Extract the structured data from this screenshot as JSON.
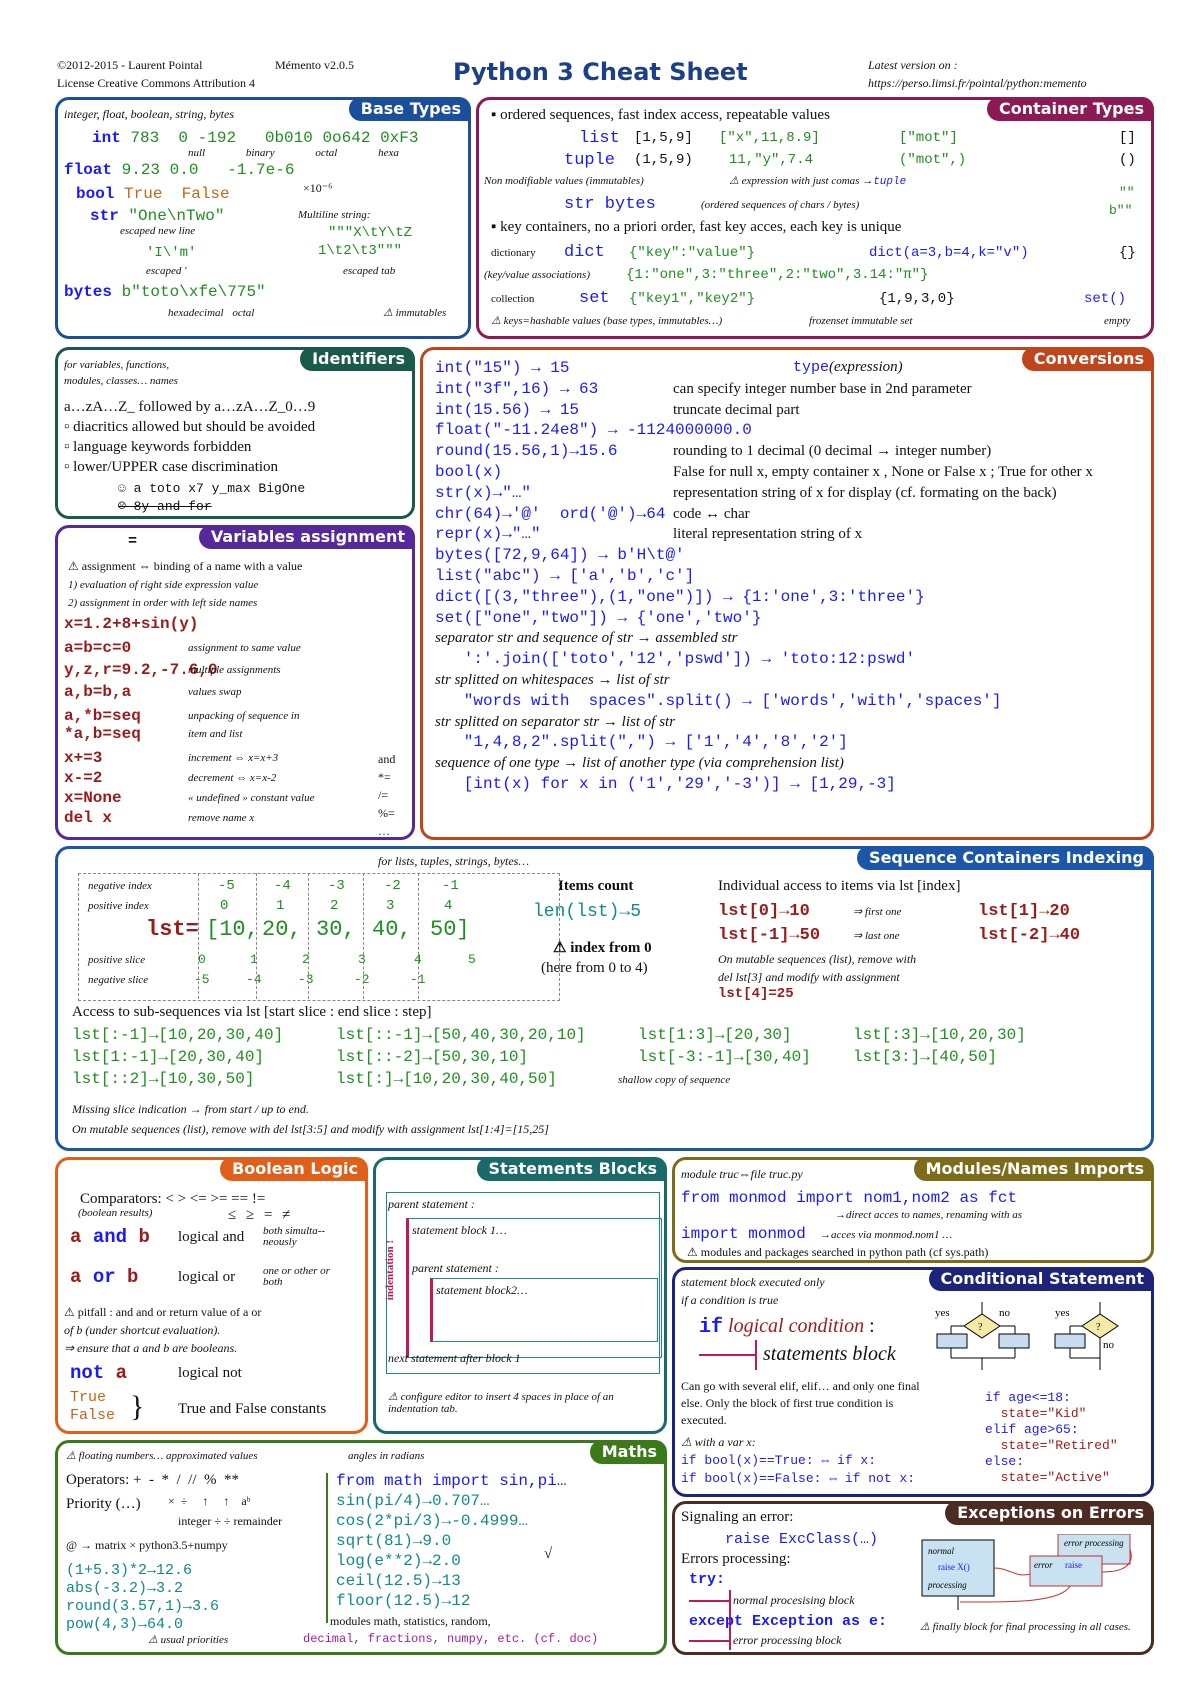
{
  "header": {
    "copyright": "©2012-2015 - Laurent Pointal",
    "version": "Mémento v2.0.5",
    "license": "License Creative Commons Attribution 4",
    "title": "Python 3 Cheat Sheet",
    "latest_label": "Latest version on :",
    "latest_url": "https://perso.limsi.fr/pointal/python:memento"
  },
  "base_types": {
    "title": "Base Types",
    "subtitle": "integer, float, boolean, string, bytes",
    "int_kw": "int",
    "int_vals": "783  0 -192   0b010 0o642 0xF3",
    "int_notes": [
      "null",
      "binary",
      "octal",
      "hexa"
    ],
    "float_kw": "float",
    "float_vals": "9.23 0.0   -1.7e-6",
    "float_note": "×10⁻⁶",
    "bool_kw": "bool",
    "bool_vals": "True  False",
    "str_kw": "str",
    "str_val": "\"One\\nTwo\"",
    "escaped_newline": "escaped new line",
    "multiline_label": "Multiline string:",
    "multiline_1": "\"\"\"X\\tY\\tZ",
    "multiline_2": "1\\t2\\t3\"\"\"",
    "str_val2": "'I\\'m'",
    "escaped_quote": "escaped '",
    "escaped_tab": "escaped tab",
    "bytes_kw": "bytes",
    "bytes_val": "b\"toto\\xfe\\775\"",
    "hex_note": "hexadecimal  octal",
    "immutables": "⚠ immutables"
  },
  "container_types": {
    "title": "Container Types",
    "ordered": "▪ ordered sequences, fast index access, repeatable values",
    "list_kw": "list",
    "list_v1": "[1,5,9]",
    "list_v2": "[\"x\",11,8.9]",
    "list_v3": "[\"mot\"]",
    "list_empty": "[]",
    "tuple_kw": "tuple",
    "tuple_v1": "(1,5,9)",
    "tuple_v2": "11,\"y\",7.4",
    "tuple_v3": "(\"mot\",)",
    "tuple_empty": "()",
    "nonmod": "Non modifiable values (immutables)",
    "expr_commas": "⚠ expression with just comas →",
    "expr_tuple": "tuple",
    "strbytes_kw": "str bytes",
    "strbytes_note": "(ordered sequences of chars / bytes)",
    "str_empty": "\"\"",
    "bytes_empty": "b\"\"",
    "key_containers": "▪ key containers, no a priori order, fast key acces, each key is unique",
    "dict_label": "dictionary",
    "dict_kw": "dict",
    "dict_v1": "{\"key\":\"value\"}",
    "dict_v2": "dict(a=3,b=4,k=\"v\")",
    "dict_empty": "{}",
    "dict_assoc": "(key/value associations)",
    "dict_v3": "{1:\"one\",3:\"three\",2:\"two\",3.14:\"π\"}",
    "set_label": "collection",
    "set_kw": "set",
    "set_v1": "{\"key1\",\"key2\"}",
    "set_v2": "{1,9,3,0}",
    "set_empty": "set()",
    "keys_hashable": "⚠ keys=hashable values (base types, immutables…)",
    "frozenset": "frozenset immutable set",
    "empty": "empty"
  },
  "identifiers": {
    "title": "Identifiers",
    "sub1": "for variables, functions,",
    "sub2": "modules, classes… names",
    "rule": "a…zA…Z_ followed by a…zA…Z_0…9",
    "bullets": [
      "diacritics allowed but should be avoided",
      "language keywords forbidden",
      "lower/UPPER case discrimination"
    ],
    "good": "☺ a toto x7 y_max BigOne",
    "bad": "☹ 8y and for"
  },
  "variables": {
    "title": "Variables assignment",
    "eq": "=",
    "binding": "⚠ assignment ⇔ binding of a name with a value",
    "step1": "1) evaluation of right side expression value",
    "step2": "2) assignment in order with left side names",
    "rows": [
      {
        "code": "x=1.2+8+sin(y)",
        "note": ""
      },
      {
        "code": "a=b=c=0",
        "note": "assignment to same value"
      },
      {
        "code": "y,z,r=9.2,-7.6,0",
        "note": "multiple assignments"
      },
      {
        "code": "a,b=b,a",
        "note": "values swap"
      },
      {
        "code": "a,*b=seq",
        "note": "unpacking of sequence in"
      },
      {
        "code": "*a,b=seq",
        "note": "item and list"
      },
      {
        "code": "x+=3",
        "note": "increment ⇔ x=x+3"
      },
      {
        "code": "x-=2",
        "note": "decrement ⇔ x=x-2"
      },
      {
        "code": "x=None",
        "note": "« undefined » constant value"
      },
      {
        "code": "del x",
        "note": "remove name x"
      }
    ],
    "ops": [
      "and",
      "*=",
      "/=",
      "%=",
      "…"
    ]
  },
  "conversions": {
    "title": "Conversions",
    "type_expr": "type(expression)",
    "rows": [
      {
        "code": "int(\"15\") → 15",
        "note": ""
      },
      {
        "code": "int(\"3f\",16) → 63",
        "note": "can specify integer number base in 2nd parameter"
      },
      {
        "code": "int(15.56) → 15",
        "note": "truncate decimal part"
      },
      {
        "code": "float(\"-11.24e8\") → -1124000000.0",
        "note": ""
      },
      {
        "code": "round(15.56,1)→15.6",
        "note": "rounding to 1 decimal (0 decimal → integer number)"
      },
      {
        "code": "bool(x)",
        "note": "False for null x, empty container x , None or False x ; True for other x"
      },
      {
        "code": "str(x)→\"…\"",
        "note": "representation string of x for display (cf. formating on the back)"
      },
      {
        "code": "chr(64)→'@'  ord('@')→64",
        "note": "code ↔ char"
      },
      {
        "code": "repr(x)→\"…\"",
        "note": "literal representation string of x"
      },
      {
        "code": "bytes([72,9,64]) → b'H\\t@'",
        "note": ""
      },
      {
        "code": "list(\"abc\") → ['a','b','c']",
        "note": ""
      },
      {
        "code": "dict([(3,\"three\"),(1,\"one\")]) → {1:'one',3:'three'}",
        "note": ""
      },
      {
        "code": "set([\"one\",\"two\"]) → {'one','two'}",
        "note": ""
      },
      {
        "code": "",
        "note": "separator str and sequence of str → assembled str"
      },
      {
        "code": "   ':'.join(['toto','12','pswd']) → 'toto:12:pswd'",
        "note": ""
      },
      {
        "code": "",
        "note": "str splitted on whitespaces → list of str"
      },
      {
        "code": "   \"words with  spaces\".split() → ['words','with','spaces']",
        "note": ""
      },
      {
        "code": "",
        "note": "str splitted on separator str → list of str"
      },
      {
        "code": "   \"1,4,8,2\".split(\",\") → ['1','4','8','2']",
        "note": ""
      },
      {
        "code": "",
        "note": "sequence of one type → list of another type (via comprehension list)"
      },
      {
        "code": "   [int(x) for x in ('1','29','-3')] → [1,29,-3]",
        "note": ""
      }
    ]
  },
  "sequence_indexing": {
    "title": "Sequence Containers Indexing",
    "subtitle": "for lists, tuples, strings, bytes…",
    "neg_index_label": "negative index",
    "neg_index": [
      "-5",
      "-4",
      "-3",
      "-2",
      "-1"
    ],
    "pos_index_label": "positive index",
    "pos_index": [
      "0",
      "1",
      "2",
      "3",
      "4"
    ],
    "lst_label": "lst=",
    "lst_values": [
      "[10,",
      "20,",
      "30,",
      "40,",
      "50]"
    ],
    "pos_slice_label": "positive slice",
    "pos_slice": [
      "0",
      "1",
      "2",
      "3",
      "4",
      "5"
    ],
    "neg_slice_label": "negative slice",
    "neg_slice": [
      "-5",
      "-4",
      "-3",
      "-2",
      "-1"
    ],
    "items_count": "Items count",
    "len": "len(lst)→5",
    "index_from0": "⚠ index from 0",
    "here": "(here from 0 to 4)",
    "individual": "Individual access to items via lst [index]",
    "access": [
      {
        "code": "lst[0]→10",
        "note": "⇒ first one"
      },
      {
        "code": "lst[1]→20",
        "note": ""
      },
      {
        "code": "lst[-1]→50",
        "note": "⇒ last one"
      },
      {
        "code": "lst[-2]→40",
        "note": ""
      }
    ],
    "mutable1": "On mutable sequences (list), remove with",
    "mutable2": "del lst[3] and modify with assignment",
    "mutable3": "lst[4]=25",
    "subseq": "Access to sub-sequences via lst [start slice : end slice : step]",
    "slices": [
      "lst[:-1]→[10,20,30,40]",
      "lst[::-1]→[50,40,30,20,10]",
      "lst[1:3]→[20,30]",
      "lst[:3]→[10,20,30]",
      "lst[1:-1]→[20,30,40]",
      "lst[::-2]→[50,30,10]",
      "lst[-3:-1]→[30,40]",
      "lst[3:]→[40,50]",
      "lst[::2]→[10,30,50]",
      "lst[:]→[10,20,30,40,50]"
    ],
    "shallow": "shallow copy of sequence",
    "missing": "Missing slice indication → from start / up to end.",
    "mutable_slice": "On mutable sequences (list), remove with del lst[3:5] and modify with assignment lst[1:4]=[15,25]"
  },
  "boolean": {
    "title": "Boolean Logic",
    "comparators": "Comparators: <  >  <=  >=  ==  !=",
    "bool_result": "(boolean results)",
    "math_ops": "≤   ≥   =   ≠",
    "and_code": "a and b",
    "and_text": "logical and",
    "and_note": "both simulta--neously",
    "or_code": "a or b",
    "or_text": "logical or",
    "or_note": "one or other or both",
    "pitfall1": "⚠ pitfall : and and or return value of a or",
    "pitfall2": "of b (under shortcut evaluation).",
    "pitfall3": "⇒ ensure that a and b are booleans.",
    "not_code": "not a",
    "not_text": "logical not",
    "true": "True",
    "false": "False",
    "const_text": "True and False constants"
  },
  "statements": {
    "title": "Statements Blocks",
    "parent1": "parent statement :",
    "block1": "statement block 1…",
    "parent2": "parent statement :",
    "block2": "statement block2…",
    "next": "next statement after block 1",
    "indent": "indentation !",
    "configure": "⚠ configure editor to insert 4 spaces in place of an indentation tab."
  },
  "modules": {
    "title": "Modules/Names Imports",
    "module_file": "module truc⇔file truc.py",
    "from_import": "from monmod import nom1,nom2 as fct",
    "direct": "→direct acces to names, renaming with as",
    "import": "import monmod",
    "via": "→acces via monmod.nom1 …",
    "searched": "⚠ modules and packages searched in python path (cf sys.path)"
  },
  "conditional": {
    "title": "Conditional Statement",
    "sub1": "statement block executed only",
    "sub2": "if a condition is true",
    "if_kw": "if",
    "cond": "logical condition",
    "colon": ":",
    "stmts": "statements block",
    "yes": "yes",
    "no": "no",
    "q": "?",
    "elif_note": "Can go with several elif, elif… and only one final else. Only the block of first true condition is executed.",
    "with_var": "⚠ with a var x:",
    "eq1": "if bool(x)==True:  ⇔ if x:",
    "eq2": "if bool(x)==False: ⇔ if not x:",
    "example": [
      "if age<=18:",
      "  state=\"Kid\"",
      "elif age>65:",
      "  state=\"Retired\"",
      "else:",
      "  state=\"Active\""
    ]
  },
  "maths": {
    "title": "Maths",
    "float_note": "⚠ floating numbers… approximated values",
    "angles": "angles in radians",
    "operators": "Operators: +  -  *  /  //  %  **",
    "priority": "Priority (…)",
    "prio_syms": "×  ÷     ↑     ↑    aᵇ",
    "int_div": "integer ÷  ÷ remainder",
    "matrix": "@ → matrix × python3.5+numpy",
    "left": [
      "(1+5.3)*2→12.6",
      "abs(-3.2)→3.2",
      "round(3.57,1)→3.6",
      "pow(4,3)→64.0"
    ],
    "usual": "⚠ usual priorities",
    "right": [
      "from math import sin,pi…",
      "sin(pi/4)→0.707…",
      "cos(2*pi/3)→-0.4999…",
      "sqrt(81)→9.0",
      "log(e**2)→2.0",
      "ceil(12.5)→13",
      "floor(12.5)→12"
    ],
    "sqrt_sym": "√",
    "modules1": "modules math, statistics, random,",
    "modules2": "decimal, fractions, numpy, etc. (cf. doc)"
  },
  "exceptions": {
    "title": "Exceptions on Errors",
    "signaling": "Signaling an error:",
    "raise": "raise ExcClass(…)",
    "processing": "Errors processing:",
    "try": "try:",
    "normal_block": "normal procesising block",
    "except": "except Exception as e:",
    "error_block": "error processing block",
    "diag_normal": "normal",
    "diag_raise": "raise X()",
    "diag_processing": "processing",
    "diag_error": "error",
    "diag_raise2": "raise",
    "diag_error_proc": "error processing",
    "finally": "⚠ finally block for final processing in all cases."
  }
}
